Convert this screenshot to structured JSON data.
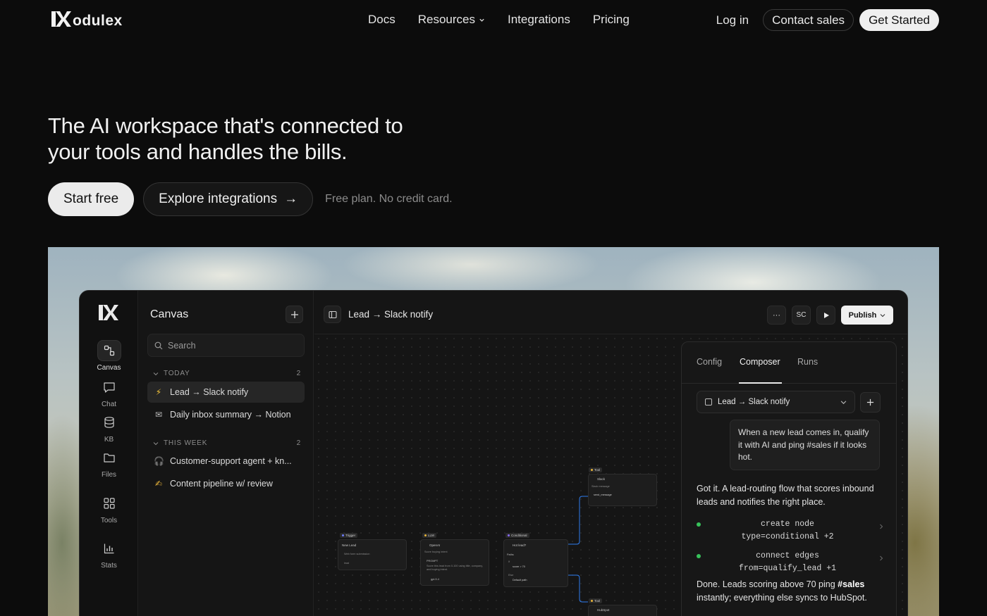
{
  "nav": {
    "brand": "odulex",
    "links": [
      "Docs",
      "Resources",
      "Integrations",
      "Pricing"
    ],
    "login": "Log in",
    "contact": "Contact sales",
    "get_started": "Get Started"
  },
  "hero": {
    "title_line1": "The AI workspace that's connected to",
    "title_line2": "your tools and handles the bills.",
    "cta_primary": "Start free",
    "cta_secondary": "Explore integrations",
    "cta_arrow": "→",
    "note": "Free plan. No credit card."
  },
  "app": {
    "rail": [
      {
        "label": "Canvas",
        "icon": "canvas-icon"
      },
      {
        "label": "Chat",
        "icon": "chat-icon"
      },
      {
        "label": "KB",
        "icon": "database-icon"
      },
      {
        "label": "Files",
        "icon": "folder-icon"
      },
      {
        "label": "Tools",
        "icon": "grid-icon"
      },
      {
        "label": "Stats",
        "icon": "chart-icon"
      }
    ],
    "sidebar": {
      "title": "Canvas",
      "search_placeholder": "Search",
      "today": {
        "label": "TODAY",
        "count": "2"
      },
      "this_week": {
        "label": "THIS WEEK",
        "count": "2"
      },
      "items": [
        {
          "emoji": "⚡",
          "label": "Lead → Slack notify"
        },
        {
          "emoji": "✉",
          "label": "Daily inbox summary → Notion"
        },
        {
          "emoji": "🎧",
          "label": "Customer-support agent + kn..."
        },
        {
          "emoji": "✍",
          "label": "Content pipeline w/ review"
        }
      ]
    },
    "topbar": {
      "title": "Lead → Slack notify",
      "avatar": "SC",
      "publish": "Publish",
      "more": "···"
    },
    "nodes": {
      "trigger": {
        "tag": "Trigger",
        "title": "New Lead",
        "sub": "Web form submission",
        "field": "lead"
      },
      "llm": {
        "tag": "LLM",
        "title": "OpenAI",
        "sub": "Score buying intent",
        "prompt_label": "PROMPT",
        "prompt": "Score this lead from 0-100 using title, company, and buying intent.",
        "model": "gpt-5.4"
      },
      "conditional": {
        "tag": "Conditional",
        "title": "Hot lead?",
        "paths_label": "Paths",
        "path1_label": "If",
        "path1": "score > 70",
        "path2_label": "Else",
        "path2": "Default path"
      },
      "slack": {
        "tag": "Tool",
        "title": "Slack",
        "sub": "Slack message",
        "field": "send_message"
      },
      "hubspot": {
        "tag": "Tool",
        "title": "HubSpot"
      }
    },
    "composer": {
      "tabs": [
        "Config",
        "Composer",
        "Runs"
      ],
      "active_tab": "Composer",
      "flow_select": "Lead → Slack notify",
      "user_message": "When a new lead comes in, qualify it with AI and ping #sales if it looks hot.",
      "ai_message": "Got it. A lead-routing flow that scores inbound leads and notifies the right place.",
      "steps": [
        {
          "line1": "create node",
          "line2": "type=conditional +2"
        },
        {
          "line1": "connect edges",
          "line2": "from=qualify_lead +1"
        }
      ],
      "done_pre": "Done. Leads scoring above 70 ping ",
      "done_bold": "#sales",
      "done_post": " instantly; everything else syncs to HubSpot."
    }
  },
  "colors": {
    "background": "#0c0c0c",
    "accent_trigger": "#6c7cff",
    "accent_llm": "#e8b43a",
    "accent_conditional": "#8a6cff",
    "edge": "#2f7df0",
    "step_dot": "#37c25a"
  }
}
